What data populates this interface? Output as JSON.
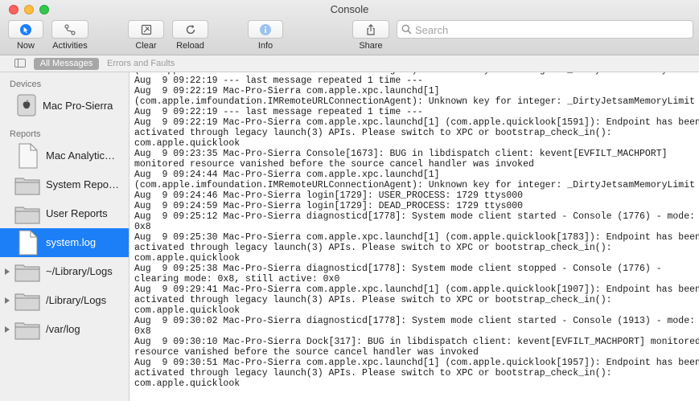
{
  "window": {
    "title": "Console"
  },
  "toolbar": {
    "now": "Now",
    "activities": "Activities",
    "clear": "Clear",
    "reload": "Reload",
    "info": "Info",
    "share": "Share",
    "search_placeholder": "Search",
    "search_value": ""
  },
  "filters": {
    "all": "All Messages",
    "errors": "Errors and Faults"
  },
  "sidebar": {
    "devices_header": "Devices",
    "device": "Mac Pro-Sierra",
    "reports_header": "Reports",
    "items": [
      {
        "label": "Mac Analytic…",
        "icon": "document-icon"
      },
      {
        "label": "System Repo…",
        "icon": "folder-icon"
      },
      {
        "label": "User Reports",
        "icon": "folder-icon"
      },
      {
        "label": "system.log",
        "icon": "document-icon",
        "selected": true
      },
      {
        "label": "~/Library/Logs",
        "icon": "folder-icon"
      },
      {
        "label": "/Library/Logs",
        "icon": "folder-icon"
      },
      {
        "label": "/var/log",
        "icon": "folder-icon"
      }
    ]
  },
  "log": {
    "lines": [
      "(com.apple.imfoundation.IMRemoteURLConnectionAgent): Unknown key for integer: _DirtyJetsamMemoryLimit",
      "Aug  9 09:22:19 --- last message repeated 1 time ---",
      "Aug  9 09:22:19 Mac-Pro-Sierra com.apple.xpc.launchd[1]",
      "(com.apple.imfoundation.IMRemoteURLConnectionAgent): Unknown key for integer: _DirtyJetsamMemoryLimit",
      "Aug  9 09:22:19 --- last message repeated 1 time ---",
      "Aug  9 09:22:19 Mac-Pro-Sierra com.apple.xpc.launchd[1] (com.apple.quicklook[1591]): Endpoint has been",
      "activated through legacy launch(3) APIs. Please switch to XPC or bootstrap_check_in():",
      "com.apple.quicklook",
      "Aug  9 09:23:35 Mac-Pro-Sierra Console[1673]: BUG in libdispatch client: kevent[EVFILT_MACHPORT]",
      "monitored resource vanished before the source cancel handler was invoked",
      "Aug  9 09:24:44 Mac-Pro-Sierra com.apple.xpc.launchd[1]",
      "(com.apple.imfoundation.IMRemoteURLConnectionAgent): Unknown key for integer: _DirtyJetsamMemoryLimit",
      "Aug  9 09:24:46 Mac-Pro-Sierra login[1729]: USER_PROCESS: 1729 ttys000",
      "Aug  9 09:24:59 Mac-Pro-Sierra login[1729]: DEAD_PROCESS: 1729 ttys000",
      "Aug  9 09:25:12 Mac-Pro-Sierra diagnosticd[1778]: System mode client started - Console (1776) - mode:",
      "0x8",
      "Aug  9 09:25:30 Mac-Pro-Sierra com.apple.xpc.launchd[1] (com.apple.quicklook[1783]): Endpoint has been",
      "activated through legacy launch(3) APIs. Please switch to XPC or bootstrap_check_in():",
      "com.apple.quicklook",
      "Aug  9 09:25:38 Mac-Pro-Sierra diagnosticd[1778]: System mode client stopped - Console (1776) -",
      "clearing mode: 0x8, still active: 0x0",
      "Aug  9 09:29:41 Mac-Pro-Sierra com.apple.xpc.launchd[1] (com.apple.quicklook[1907]): Endpoint has been",
      "activated through legacy launch(3) APIs. Please switch to XPC or bootstrap_check_in():",
      "com.apple.quicklook",
      "Aug  9 09:30:02 Mac-Pro-Sierra diagnosticd[1778]: System mode client started - Console (1913) - mode:",
      "0x8",
      "Aug  9 09:30:10 Mac-Pro-Sierra Dock[317]: BUG in libdispatch client: kevent[EVFILT_MACHPORT] monitored",
      "resource vanished before the source cancel handler was invoked",
      "Aug  9 09:30:51 Mac-Pro-Sierra com.apple.xpc.launchd[1] (com.apple.quicklook[1957]): Endpoint has been",
      "activated through legacy launch(3) APIs. Please switch to XPC or bootstrap_check_in():",
      "com.apple.quicklook"
    ]
  }
}
